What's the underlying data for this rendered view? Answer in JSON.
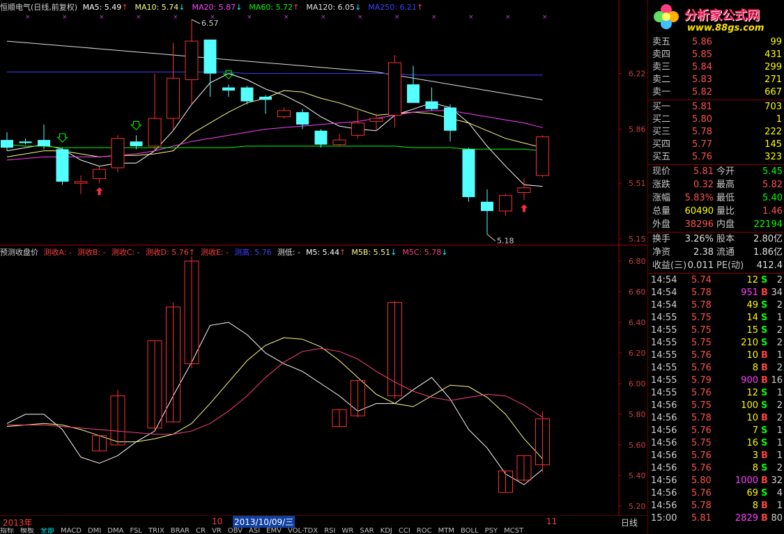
{
  "main_header": {
    "title": "恒顺电气(日线,前复权)",
    "items": [
      {
        "label": "MA5: 5.49",
        "arrow": "↑",
        "color": "#ffffff",
        "arrow_color": "#ff4040"
      },
      {
        "label": "MA10: 5.74",
        "arrow": "↓",
        "color": "#ffff80",
        "arrow_color": "#00ffff"
      },
      {
        "label": "MA20: 5.87",
        "arrow": "↓",
        "color": "#ff40ff",
        "arrow_color": "#00ffff"
      },
      {
        "label": "MA60: 5.72",
        "arrow": "↑",
        "color": "#00ff00",
        "arrow_color": "#ff4040"
      },
      {
        "label": "MA120: 6.05",
        "arrow": "↓",
        "color": "#e0e0e0",
        "arrow_color": "#00ffff"
      },
      {
        "label": "MA250: 6.21",
        "arrow": "↑",
        "color": "#4040ff",
        "arrow_color": "#ff4040"
      }
    ]
  },
  "indicator_header": {
    "title": "预测收盘价",
    "items": [
      {
        "label": "测收A: -",
        "color": "#ff4040"
      },
      {
        "label": "测收B: -",
        "color": "#ff4040"
      },
      {
        "label": "测收C: -",
        "color": "#ff4040"
      },
      {
        "label": "测收D: 5.76",
        "color": "#ff4040",
        "arrow": "↑",
        "arrow_color": "#ff4040"
      },
      {
        "label": "测收E: -",
        "color": "#ff4040"
      },
      {
        "label": "测高: 5.76",
        "color": "#4040ff"
      },
      {
        "label": "测低: -",
        "color": "#e0e0e0"
      },
      {
        "label": "M5: 5.44",
        "color": "#ffffff",
        "arrow": "↑",
        "arrow_color": "#ff4040"
      },
      {
        "label": "M5B: 5.51",
        "color": "#ffff80",
        "arrow": "↓",
        "arrow_color": "#00ffff"
      },
      {
        "label": "M5C: 5.78",
        "color": "#ff4080",
        "arrow": "↓",
        "arrow_color": "#00ffff"
      }
    ]
  },
  "logo": {
    "name": "分析家公式网",
    "url": "www.88gs.com"
  },
  "order_book": {
    "sell": [
      {
        "label": "卖五",
        "price": "5.86",
        "vol": "99"
      },
      {
        "label": "卖四",
        "price": "5.85",
        "vol": "431"
      },
      {
        "label": "卖三",
        "price": "5.84",
        "vol": "299"
      },
      {
        "label": "卖二",
        "price": "5.83",
        "vol": "271"
      },
      {
        "label": "卖一",
        "price": "5.82",
        "vol": "667"
      }
    ],
    "buy": [
      {
        "label": "买一",
        "price": "5.81",
        "vol": "703"
      },
      {
        "label": "买二",
        "price": "5.80",
        "vol": "1"
      },
      {
        "label": "买三",
        "price": "5.78",
        "vol": "222"
      },
      {
        "label": "买四",
        "price": "5.77",
        "vol": "145"
      },
      {
        "label": "买五",
        "price": "5.76",
        "vol": "323"
      }
    ]
  },
  "stats": [
    {
      "l1": "现价",
      "v1": "5.81",
      "c1": "#ff5050",
      "l2": "今开",
      "v2": "5.45",
      "c2": "#00ff00"
    },
    {
      "l1": "涨跌",
      "v1": "0.32",
      "c1": "#ff5050",
      "l2": "最高",
      "v2": "5.82",
      "c2": "#ff5050"
    },
    {
      "l1": "涨幅",
      "v1": "5.83%",
      "c1": "#ff5050",
      "l2": "最低",
      "v2": "5.40",
      "c2": "#00ff00"
    },
    {
      "l1": "总量",
      "v1": "60490",
      "c1": "#ffff00",
      "l2": "量比",
      "v2": "1.46",
      "c2": "#ff5050"
    },
    {
      "l1": "外盘",
      "v1": "38296",
      "c1": "#ff5050",
      "l2": "内盘",
      "v2": "22194",
      "c2": "#00ff00"
    }
  ],
  "stats2": [
    {
      "l1": "换手",
      "v1": "3.26%",
      "c1": "#e0e0e0",
      "l2": "股本",
      "v2": "2.80亿",
      "c2": "#e0e0e0"
    },
    {
      "l1": "净资",
      "v1": "2.38",
      "c1": "#e0e0e0",
      "l2": "流通",
      "v2": "1.86亿",
      "c2": "#e0e0e0"
    },
    {
      "l1": "收益(三)",
      "v1": "0.011",
      "c1": "#e0e0e0",
      "l2": "PE(动)",
      "v2": "412.4",
      "c2": "#e0e0e0"
    }
  ],
  "ticks": [
    {
      "t": "14:54",
      "p": "5.74",
      "v": "12",
      "bs": "S",
      "c": "2"
    },
    {
      "t": "14:54",
      "p": "5.78",
      "v": "951",
      "bs": "B",
      "c": "34"
    },
    {
      "t": "14:54",
      "p": "5.78",
      "v": "49",
      "bs": "S",
      "c": "2"
    },
    {
      "t": "14:55",
      "p": "5.75",
      "v": "14",
      "bs": "S",
      "c": "1"
    },
    {
      "t": "14:55",
      "p": "5.75",
      "v": "15",
      "bs": "S",
      "c": "2"
    },
    {
      "t": "14:55",
      "p": "5.75",
      "v": "210",
      "bs": "S",
      "c": "2"
    },
    {
      "t": "14:55",
      "p": "5.76",
      "v": "10",
      "bs": "B",
      "c": "1"
    },
    {
      "t": "14:55",
      "p": "5.76",
      "v": "8",
      "bs": "B",
      "c": "2"
    },
    {
      "t": "14:55",
      "p": "5.79",
      "v": "900",
      "bs": "B",
      "c": "16"
    },
    {
      "t": "14:55",
      "p": "5.76",
      "v": "12",
      "bs": "S",
      "c": "1"
    },
    {
      "t": "14:56",
      "p": "5.75",
      "v": "100",
      "bs": "S",
      "c": "2"
    },
    {
      "t": "14:56",
      "p": "5.78",
      "v": "10",
      "bs": "B",
      "c": "2"
    },
    {
      "t": "14:56",
      "p": "5.76",
      "v": "7",
      "bs": "S",
      "c": "1"
    },
    {
      "t": "14:56",
      "p": "5.75",
      "v": "16",
      "bs": "S",
      "c": "1"
    },
    {
      "t": "14:56",
      "p": "5.76",
      "v": "3",
      "bs": "B",
      "c": "1"
    },
    {
      "t": "14:56",
      "p": "5.76",
      "v": "8",
      "bs": "S",
      "c": "2"
    },
    {
      "t": "14:56",
      "p": "5.80",
      "v": "1000",
      "bs": "B",
      "c": "32"
    },
    {
      "t": "14:56",
      "p": "5.76",
      "v": "69",
      "bs": "S",
      "c": "4"
    },
    {
      "t": "14:56",
      "p": "5.78",
      "v": "8",
      "bs": "B",
      "c": "1"
    },
    {
      "t": "15:00",
      "p": "5.81",
      "v": "2829",
      "bs": "B",
      "c": "80"
    }
  ],
  "xaxis": {
    "year": "2013年",
    "m10": "10",
    "selected": "2013/10/09/三",
    "m11": "11",
    "period": "日线"
  },
  "tabs": [
    "指标",
    "模板",
    "全部",
    "MACD",
    "DMI",
    "DMA",
    "FSL",
    "TRIX",
    "BRAR",
    "CR",
    "VR",
    "OBV",
    "ASI",
    "EMV",
    "VOL-TDX",
    "RSI",
    "WR",
    "SAR",
    "KDJ",
    "CCI",
    "ROC",
    "MTM",
    "BOLL",
    "PSY",
    "MCST"
  ],
  "colors": {
    "up": "#ff3030",
    "down": "#54ffff",
    "frame": "#b00000"
  },
  "chart_data": [
    {
      "type": "candlestick",
      "title": "恒顺电气(日线,前复权)",
      "ylim": [
        5.15,
        6.57
      ],
      "yticks": [
        "6.22",
        "5.86",
        "5.51",
        "5.15"
      ],
      "annotations": [
        {
          "text": "6.57"
        },
        {
          "text": "5.18"
        }
      ],
      "candles": [
        {
          "o": 5.79,
          "h": 5.84,
          "l": 5.72,
          "c": 5.74
        },
        {
          "o": 5.78,
          "h": 5.8,
          "l": 5.76,
          "c": 5.77
        },
        {
          "o": 5.79,
          "h": 5.89,
          "l": 5.73,
          "c": 5.75
        },
        {
          "o": 5.73,
          "h": 5.74,
          "l": 5.5,
          "c": 5.52
        },
        {
          "o": 5.51,
          "h": 5.56,
          "l": 5.44,
          "c": 5.52
        },
        {
          "o": 5.54,
          "h": 5.62,
          "l": 5.51,
          "c": 5.6
        },
        {
          "o": 5.61,
          "h": 5.82,
          "l": 5.58,
          "c": 5.8
        },
        {
          "o": 5.78,
          "h": 5.82,
          "l": 5.73,
          "c": 5.75
        },
        {
          "o": 5.75,
          "h": 6.22,
          "l": 5.72,
          "c": 5.93
        },
        {
          "o": 5.93,
          "h": 6.42,
          "l": 5.85,
          "c": 6.19
        },
        {
          "o": 6.18,
          "h": 6.57,
          "l": 6.02,
          "c": 6.43
        },
        {
          "o": 6.44,
          "h": 6.44,
          "l": 6.07,
          "c": 6.22
        },
        {
          "o": 6.13,
          "h": 6.15,
          "l": 6.07,
          "c": 6.11
        },
        {
          "o": 6.13,
          "h": 6.14,
          "l": 6.02,
          "c": 6.04
        },
        {
          "o": 6.07,
          "h": 6.08,
          "l": 5.96,
          "c": 6.05
        },
        {
          "o": 5.94,
          "h": 6.0,
          "l": 5.93,
          "c": 5.98
        },
        {
          "o": 5.97,
          "h": 5.99,
          "l": 5.86,
          "c": 5.89
        },
        {
          "o": 5.85,
          "h": 5.86,
          "l": 5.74,
          "c": 5.76
        },
        {
          "o": 5.76,
          "h": 5.83,
          "l": 5.75,
          "c": 5.79
        },
        {
          "o": 5.82,
          "h": 5.98,
          "l": 5.8,
          "c": 5.9
        },
        {
          "o": 5.91,
          "h": 5.96,
          "l": 5.85,
          "c": 5.93
        },
        {
          "o": 5.95,
          "h": 6.34,
          "l": 5.87,
          "c": 6.29
        },
        {
          "o": 6.15,
          "h": 6.27,
          "l": 6.04,
          "c": 6.03
        },
        {
          "o": 6.04,
          "h": 6.13,
          "l": 5.98,
          "c": 5.99
        },
        {
          "o": 6.0,
          "h": 6.02,
          "l": 5.78,
          "c": 5.85
        },
        {
          "o": 5.73,
          "h": 5.74,
          "l": 5.39,
          "c": 5.42
        },
        {
          "o": 5.39,
          "h": 5.47,
          "l": 5.18,
          "c": 5.33
        },
        {
          "o": 5.33,
          "h": 5.44,
          "l": 5.3,
          "c": 5.43
        },
        {
          "o": 5.45,
          "h": 5.54,
          "l": 5.4,
          "c": 5.48
        },
        {
          "o": 5.56,
          "h": 5.82,
          "l": 5.55,
          "c": 5.81
        }
      ],
      "ma_lines": [
        {
          "name": "MA5",
          "color": "#ffffff",
          "values": [
            5.72,
            5.74,
            5.76,
            5.73,
            5.66,
            5.62,
            5.64,
            5.64,
            5.72,
            5.85,
            6.02,
            6.16,
            6.22,
            6.18,
            6.12,
            6.08,
            6.02,
            5.94,
            5.88,
            5.86,
            5.85,
            5.95,
            5.99,
            6.03,
            6.0,
            5.9,
            5.75,
            5.62,
            5.5,
            5.49
          ]
        },
        {
          "name": "MA10",
          "color": "#ffff80",
          "values": [
            5.68,
            5.7,
            5.72,
            5.72,
            5.7,
            5.68,
            5.69,
            5.69,
            5.7,
            5.72,
            5.83,
            5.9,
            5.97,
            6.03,
            6.06,
            6.11,
            6.1,
            6.06,
            6.03,
            5.99,
            5.95,
            5.96,
            5.97,
            5.96,
            5.93,
            5.9,
            5.85,
            5.8,
            5.77,
            5.74
          ]
        },
        {
          "name": "MA20",
          "color": "#ff40ff",
          "values": [
            5.66,
            5.67,
            5.68,
            5.68,
            5.68,
            5.68,
            5.69,
            5.7,
            5.72,
            5.75,
            5.78,
            5.8,
            5.82,
            5.84,
            5.86,
            5.87,
            5.88,
            5.89,
            5.9,
            5.91,
            5.93,
            5.95,
            5.97,
            5.98,
            5.98,
            5.96,
            5.94,
            5.92,
            5.9,
            5.87
          ]
        },
        {
          "name": "MA60",
          "color": "#00ff00",
          "values": [
            5.76,
            5.75,
            5.75,
            5.74,
            5.74,
            5.74,
            5.74,
            5.74,
            5.74,
            5.74,
            5.74,
            5.74,
            5.74,
            5.75,
            5.75,
            5.75,
            5.75,
            5.75,
            5.75,
            5.75,
            5.75,
            5.75,
            5.74,
            5.74,
            5.74,
            5.73,
            5.73,
            5.73,
            5.73,
            5.72
          ]
        },
        {
          "name": "MA120",
          "color": "#e0e0e0",
          "values": [
            6.43,
            6.42,
            6.41,
            6.4,
            6.39,
            6.38,
            6.37,
            6.36,
            6.35,
            6.34,
            6.33,
            6.32,
            6.31,
            6.3,
            6.29,
            6.28,
            6.27,
            6.26,
            6.25,
            6.24,
            6.23,
            6.21,
            6.19,
            6.17,
            6.15,
            6.13,
            6.11,
            6.09,
            6.07,
            6.05
          ]
        },
        {
          "name": "MA250",
          "color": "#4040ff",
          "values": [
            6.23,
            6.23,
            6.23,
            6.23,
            6.23,
            6.23,
            6.23,
            6.23,
            6.23,
            6.23,
            6.23,
            6.23,
            6.23,
            6.22,
            6.22,
            6.22,
            6.22,
            6.22,
            6.22,
            6.22,
            6.22,
            6.22,
            6.21,
            6.21,
            6.21,
            6.21,
            6.21,
            6.21,
            6.21,
            6.21
          ]
        }
      ],
      "signals": [
        {
          "i": 3,
          "dir": "down"
        },
        {
          "i": 5,
          "dir": "up"
        },
        {
          "i": 7,
          "dir": "down"
        },
        {
          "i": 12,
          "dir": "down"
        },
        {
          "i": 28,
          "dir": "up"
        }
      ]
    },
    {
      "type": "candlestick",
      "title": "预测收盘价",
      "ylim": [
        5.2,
        6.8
      ],
      "yticks": [
        "6.80",
        "6.60",
        "6.40",
        "6.20",
        "6.00",
        "5.80",
        "5.60",
        "5.40",
        "5.20"
      ],
      "boxes": [
        {
          "i": 5,
          "o": 5.56,
          "c": 5.66,
          "h": 5.66,
          "l": 5.56
        },
        {
          "i": 6,
          "o": 5.6,
          "c": 5.92,
          "h": 5.96,
          "l": 5.6
        },
        {
          "i": 8,
          "o": 5.71,
          "c": 6.28,
          "h": 6.28,
          "l": 5.7
        },
        {
          "i": 9,
          "o": 5.75,
          "c": 6.5,
          "h": 6.53,
          "l": 5.75
        },
        {
          "i": 10,
          "o": 6.13,
          "c": 6.8,
          "h": 6.83,
          "l": 6.1
        },
        {
          "i": 18,
          "o": 5.72,
          "c": 5.83,
          "h": 5.83,
          "l": 5.72
        },
        {
          "i": 19,
          "o": 5.79,
          "c": 6.02,
          "h": 6.02,
          "l": 5.78
        },
        {
          "i": 21,
          "o": 5.92,
          "c": 6.53,
          "h": 6.54,
          "l": 5.9
        },
        {
          "i": 27,
          "o": 5.29,
          "c": 5.43,
          "h": 5.43,
          "l": 5.29
        },
        {
          "i": 28,
          "o": 5.37,
          "c": 5.53,
          "h": 5.53,
          "l": 5.36
        },
        {
          "i": 29,
          "o": 5.47,
          "c": 5.77,
          "h": 5.82,
          "l": 5.42
        }
      ],
      "lines": [
        {
          "name": "M5",
          "color": "#ffffff",
          "values": [
            5.74,
            5.8,
            5.8,
            5.7,
            5.52,
            5.48,
            5.53,
            5.62,
            5.69,
            5.92,
            6.14,
            6.38,
            6.4,
            6.32,
            6.2,
            6.13,
            6.08,
            6.0,
            5.92,
            5.82,
            5.87,
            5.87,
            5.96,
            6.04,
            5.9,
            5.7,
            5.58,
            5.41,
            5.34,
            5.44
          ]
        },
        {
          "name": "M5B",
          "color": "#ffff80",
          "values": [
            5.72,
            5.73,
            5.74,
            5.73,
            5.7,
            5.66,
            5.62,
            5.62,
            5.64,
            5.67,
            5.74,
            5.87,
            6.01,
            6.15,
            6.25,
            6.3,
            6.29,
            6.24,
            6.15,
            6.04,
            5.93,
            5.87,
            5.85,
            5.92,
            5.99,
            5.98,
            5.91,
            5.8,
            5.64,
            5.51
          ]
        },
        {
          "name": "M5C",
          "color": "#ff4080",
          "values": [
            5.73,
            5.73,
            5.73,
            5.72,
            5.71,
            5.7,
            5.69,
            5.68,
            5.67,
            5.67,
            5.69,
            5.74,
            5.82,
            5.92,
            6.04,
            6.14,
            6.21,
            6.23,
            6.21,
            6.16,
            6.08,
            6.01,
            5.95,
            5.91,
            5.89,
            5.91,
            5.93,
            5.92,
            5.86,
            5.78
          ]
        }
      ]
    }
  ]
}
